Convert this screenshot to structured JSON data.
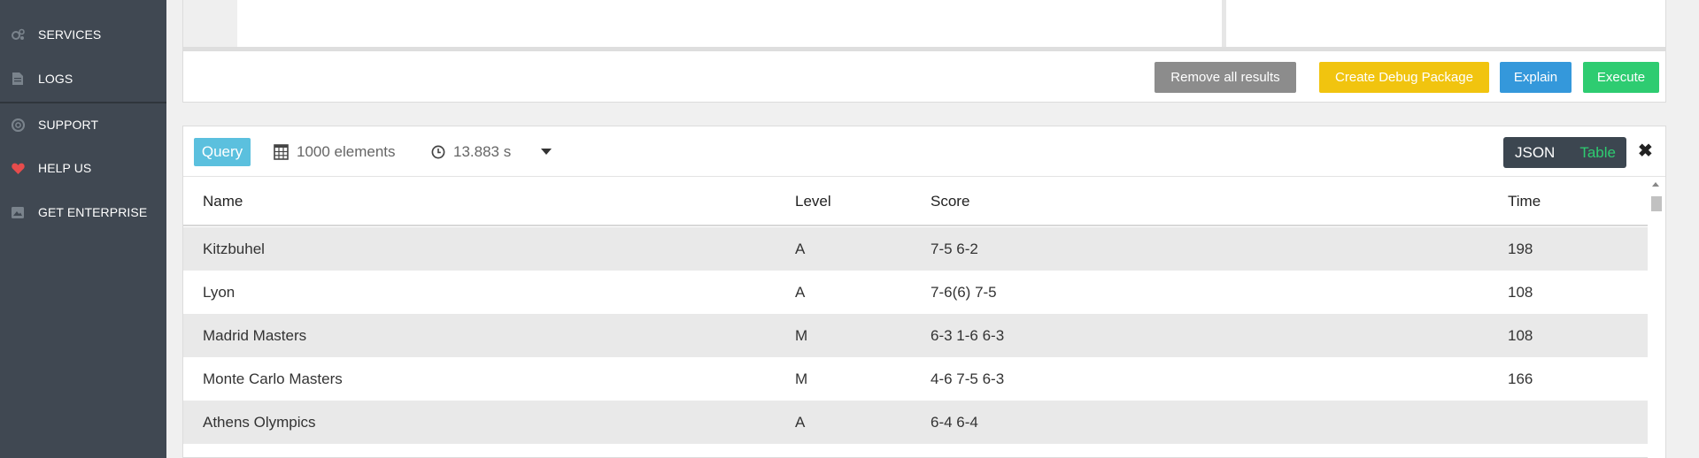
{
  "sidebar": {
    "items": [
      {
        "label": "SERVICES",
        "icon": "services-icon"
      },
      {
        "label": "LOGS",
        "icon": "logs-icon"
      },
      {
        "label": "SUPPORT",
        "icon": "support-icon"
      },
      {
        "label": "HELP US",
        "icon": "heart-icon"
      },
      {
        "label": "GET ENTERPRISE",
        "icon": "enterprise-icon"
      }
    ]
  },
  "actions": {
    "remove_label": "Remove all results",
    "debug_label": "Create Debug Package",
    "explain_label": "Explain",
    "execute_label": "Execute"
  },
  "result": {
    "badge": "Query",
    "elements": "1000 elements",
    "time": "13.883 s",
    "view_json": "JSON",
    "view_table": "Table",
    "active_view": "Table"
  },
  "table": {
    "headers": [
      "Name",
      "Level",
      "Score",
      "Time"
    ],
    "rows": [
      [
        "Kitzbuhel",
        "A",
        "7-5 6-2",
        "198"
      ],
      [
        "Lyon",
        "A",
        "7-6(6) 7-5",
        "108"
      ],
      [
        "Madrid Masters",
        "M",
        "6-3 1-6 6-3",
        "108"
      ],
      [
        "Monte Carlo Masters",
        "M",
        "4-6 7-5 6-3",
        "166"
      ],
      [
        "Athens Olympics",
        "A",
        "6-4 6-4",
        ""
      ]
    ]
  },
  "colors": {
    "sidebar_bg": "#404852",
    "remove_btn": "#8c8c8c",
    "debug_btn": "#f1c40f",
    "explain_btn": "#3498db",
    "execute_btn": "#2ecc71",
    "query_badge": "#5bc0de",
    "heart": "#e74c4c"
  }
}
